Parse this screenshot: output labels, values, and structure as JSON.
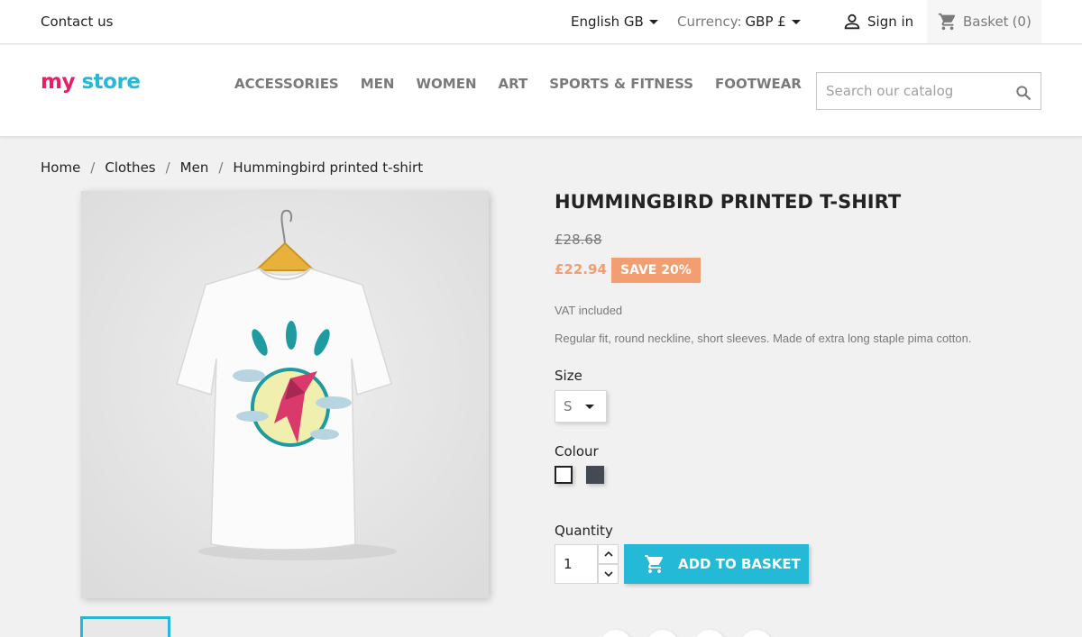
{
  "topbar": {
    "contact": "Contact us",
    "language": "English GB",
    "currency_label": "Currency:",
    "currency_value": "GBP £",
    "signin": "Sign in",
    "basket_label": "Basket",
    "basket_count": "(0)"
  },
  "header": {
    "logo_word1": "my",
    "logo_word2": "store",
    "nav": [
      "ACCESSORIES",
      "MEN",
      "WOMEN",
      "ART",
      "SPORTS & FITNESS",
      "FOOTWEAR"
    ],
    "search_placeholder": "Search our catalog"
  },
  "breadcrumb": [
    "Home",
    "Clothes",
    "Men",
    "Hummingbird printed t-shirt"
  ],
  "product": {
    "title": "HUMMINGBIRD PRINTED T-SHIRT",
    "old_price": "£28.68",
    "new_price": "£22.94",
    "discount": "SAVE 20%",
    "vat": "VAT included",
    "description": "Regular fit, round neckline, short sleeves. Made of extra long staple pima cotton.",
    "size_label": "Size",
    "size_value": "S",
    "colour_label": "Colour",
    "colours": [
      "#ffffff",
      "#434a54"
    ],
    "quantity_label": "Quantity",
    "quantity_value": "1",
    "add_button": "ADD TO BASKET"
  },
  "colors": {
    "accent": "#24b9d7",
    "discount": "#f39d72"
  }
}
